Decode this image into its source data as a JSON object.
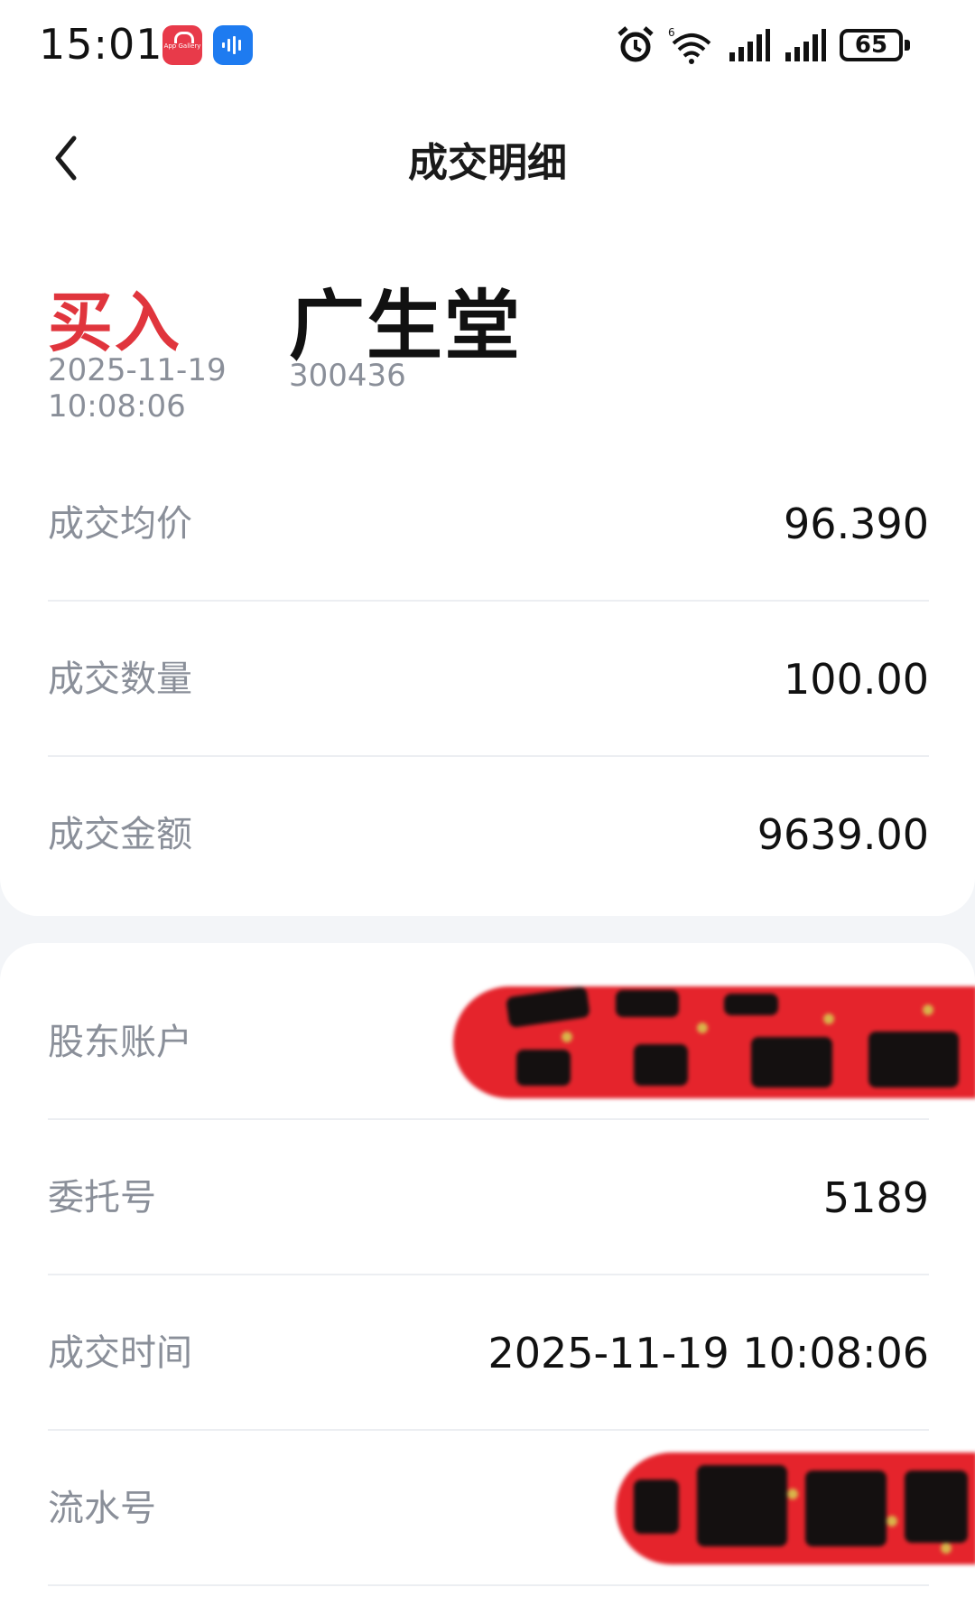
{
  "status_bar": {
    "time": "15:01",
    "battery": "65",
    "app_gallery_text": "App Gallery"
  },
  "header": {
    "title": "成交明细"
  },
  "trade": {
    "direction": "买入",
    "date": "2025-11-19",
    "time": "10:08:06",
    "stock_name": "广生堂",
    "stock_code": "300436"
  },
  "summary": [
    {
      "label": "成交均价",
      "value": "96.390"
    },
    {
      "label": "成交数量",
      "value": "100.00"
    },
    {
      "label": "成交金额",
      "value": "9639.00"
    }
  ],
  "details": [
    {
      "label": "股东账户",
      "value": null,
      "redacted": true
    },
    {
      "label": "委托号",
      "value": "5189"
    },
    {
      "label": "成交时间",
      "value": "2025-11-19 10:08:06"
    },
    {
      "label": "流水号",
      "value": null,
      "redacted": true
    }
  ],
  "colors": {
    "buy_red": "#e0353d",
    "label_gray": "#8a8f99",
    "page_bg": "#f3f5f8"
  }
}
